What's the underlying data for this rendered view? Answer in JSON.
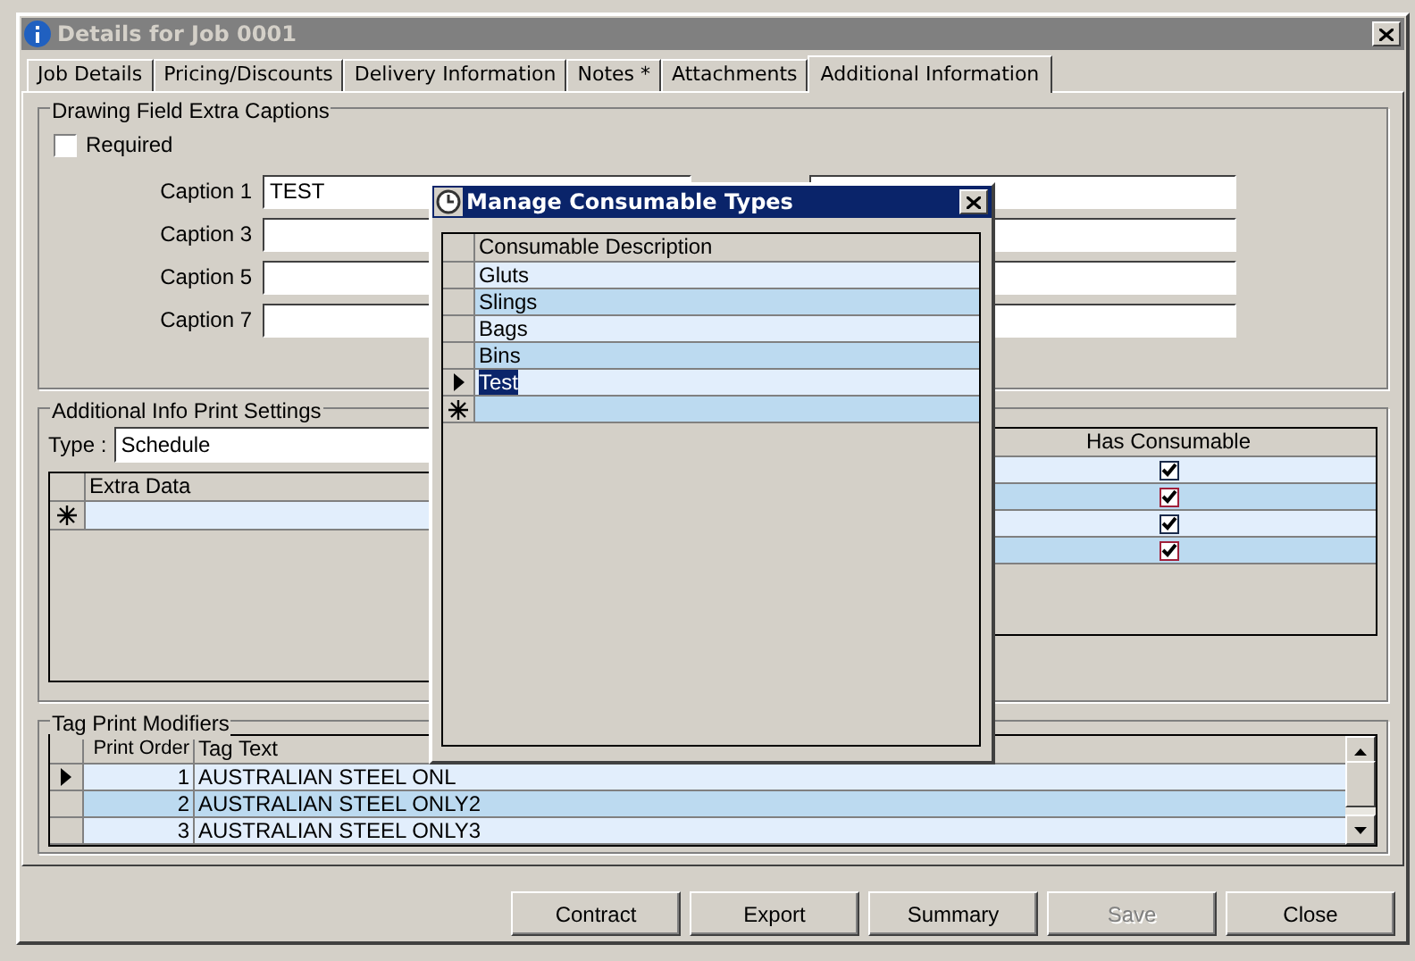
{
  "window": {
    "title": "Details for Job 0001"
  },
  "tabs": [
    {
      "label": "Job Details",
      "selected": false
    },
    {
      "label": "Pricing/Discounts",
      "selected": false
    },
    {
      "label": "Delivery Information",
      "selected": false
    },
    {
      "label": "Notes *",
      "selected": false
    },
    {
      "label": "Attachments",
      "selected": false
    },
    {
      "label": "Additional Information",
      "selected": true
    }
  ],
  "drawing_captions": {
    "title": "Drawing Field Extra Captions",
    "required": {
      "label": "Required",
      "checked": false
    },
    "captions": [
      {
        "label": "Caption 1",
        "value": "TEST"
      },
      {
        "label": "Caption 3"
      },
      {
        "label": "Caption 5"
      },
      {
        "label": "Caption 7"
      }
    ]
  },
  "print_settings": {
    "title": "Additional Info Print Settings",
    "type_label": "Type :",
    "type_value": "Schedule",
    "extra_column": "Extra Data",
    "consumable_column": "Has Consumable",
    "consumable_rows": [
      {
        "checked": true
      },
      {
        "checked": true
      },
      {
        "checked": true
      },
      {
        "checked": true
      }
    ]
  },
  "tag_print_modifiers": {
    "title": "Tag Print Modifiers",
    "columns": [
      "Print Order",
      "Tag Text"
    ],
    "rows": [
      {
        "order": "1",
        "text": "AUSTRALIAN STEEL ONL",
        "current": true
      },
      {
        "order": "2",
        "text": "AUSTRALIAN STEEL ONLY2",
        "current": false
      },
      {
        "order": "3",
        "text": "AUSTRALIAN STEEL ONLY3",
        "current": false
      }
    ]
  },
  "buttons": [
    {
      "label": "Contract",
      "disabled": false
    },
    {
      "label": "Export",
      "disabled": false
    },
    {
      "label": "Summary",
      "disabled": false
    },
    {
      "label": "Save",
      "disabled": true
    },
    {
      "label": "Close",
      "disabled": false
    }
  ],
  "consumable_dialog": {
    "title": "Manage Consumable Types",
    "column": "Consumable Description",
    "rows": [
      {
        "text": "Gluts",
        "current": false
      },
      {
        "text": "Slings",
        "current": false
      },
      {
        "text": "Bags",
        "current": false
      },
      {
        "text": "Bins",
        "current": false
      },
      {
        "text": "Test",
        "current": true
      }
    ]
  }
}
